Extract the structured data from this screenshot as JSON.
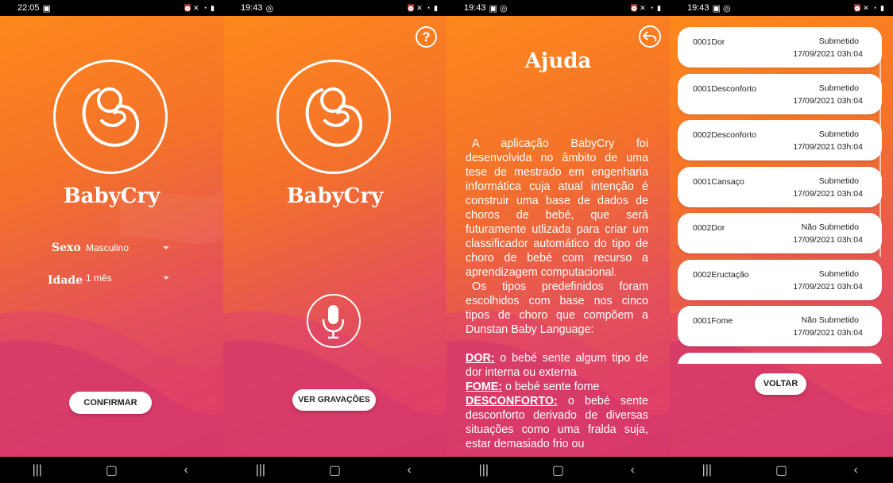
{
  "screens": [
    {
      "status_time": "22:05",
      "app_name": "BabyCry",
      "form": {
        "sexo_label": "Sexo",
        "sexo_value": "Masculino",
        "idade_label": "Idade",
        "idade_value": "1 mês"
      },
      "confirm_label": "CONFIRMAR"
    },
    {
      "status_time": "19:43",
      "app_name": "BabyCry",
      "help_icon": "?",
      "recordings_label": "VER GRAVAÇÕES"
    },
    {
      "status_time": "19:43",
      "title": "Ajuda",
      "paragraph1": "A aplicação BabyCry foi desenvolvida no âmbito de uma tese de mestrado em engenharia informática cuja atual intenção é construir uma base de dados de choros de bebé, que será futuramente utlizada para criar um classificador automático do tipo de choro de bebé com recurso a aprendizagem computacional.",
      "paragraph2": "Os tipos predefinidos foram escolhidos com base nos cinco tipos de choro que compõem a Dunstan Baby Language:",
      "definitions": [
        {
          "term": "DOR:",
          "text": " o bebé sente algum tipo de dor interna ou externa"
        },
        {
          "term": "FOME:",
          "text": " o bebé sente fome"
        },
        {
          "term": "DESCONFORTO:",
          "text": " o bebé sente desconforto derivado de diversas situações como uma fralda suja, estar demasiado frio ou"
        }
      ]
    },
    {
      "status_time": "19:43",
      "recordings": [
        {
          "name": "0001Dor",
          "status": "Submetido",
          "date": "17/09/2021  03h:04"
        },
        {
          "name": "0001Desconforto",
          "status": "Submetido",
          "date": "17/09/2021  03h:04"
        },
        {
          "name": "0002Desconforto",
          "status": "Submetido",
          "date": "17/09/2021  03h:04"
        },
        {
          "name": "0001Cansaço",
          "status": "Submetido",
          "date": "17/09/2021  03h:04"
        },
        {
          "name": "0002Dor",
          "status": "Não Submetido",
          "date": "17/09/2021  03h:04"
        },
        {
          "name": "0002Eructação",
          "status": "Submetido",
          "date": "17/09/2021  03h:04"
        },
        {
          "name": "0001Fome",
          "status": "Não Submetido",
          "date": "17/09/2021  03h:04"
        },
        {
          "name": "",
          "status": "",
          "date": ""
        }
      ],
      "back_label": "VOLTAR"
    }
  ],
  "colors": {
    "gradient_top": "#ff8a1a",
    "gradient_bottom": "#d8346c",
    "wave_light": "#ff9a2e",
    "wave_dark": "#c9305e"
  },
  "icons": {
    "status_left": "image-icon",
    "status_right": "alarm-mute-wifi-signal-battery-icons",
    "logo": "fetus-icon",
    "mic": "microphone-icon",
    "back": "undo-arrow-icon",
    "help": "question-icon"
  }
}
